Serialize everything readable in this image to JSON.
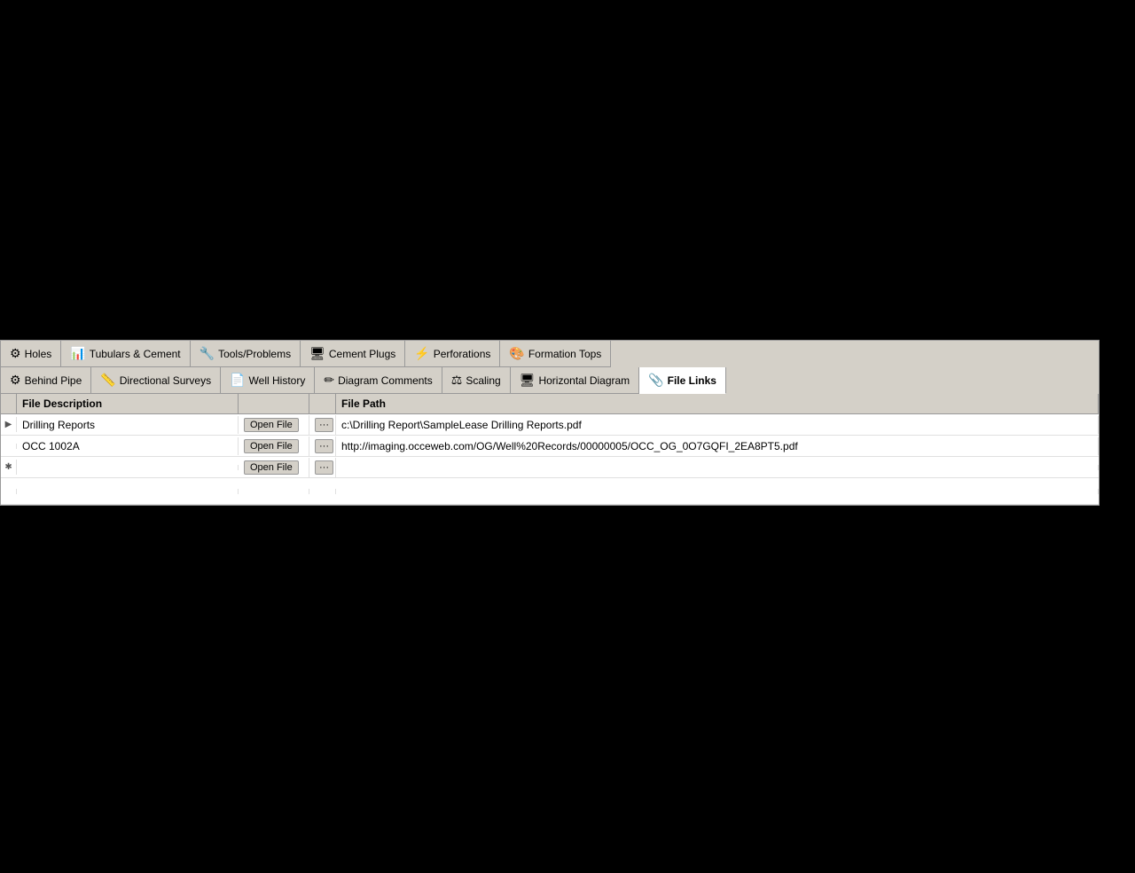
{
  "tabs_row1": [
    {
      "id": "holes",
      "label": "Holes",
      "icon": "⚙",
      "active": false
    },
    {
      "id": "tubulars-cement",
      "label": "Tubulars & Cement",
      "icon": "📊",
      "active": false
    },
    {
      "id": "tools-problems",
      "label": "Tools/Problems",
      "icon": "🔧",
      "active": false
    },
    {
      "id": "cement-plugs",
      "label": "Cement Plugs",
      "icon": "🖥",
      "active": false
    },
    {
      "id": "perforations",
      "label": "Perforations",
      "icon": "⚡",
      "active": false
    },
    {
      "id": "formation-tops",
      "label": "Formation Tops",
      "icon": "🎨",
      "active": false
    }
  ],
  "tabs_row2": [
    {
      "id": "behind-pipe",
      "label": "Behind Pipe",
      "icon": "⚙",
      "active": false
    },
    {
      "id": "directional-surveys",
      "label": "Directional Surveys",
      "icon": "📏",
      "active": false
    },
    {
      "id": "well-history",
      "label": "Well History",
      "icon": "📄",
      "active": false
    },
    {
      "id": "diagram-comments",
      "label": "Diagram Comments",
      "icon": "✏",
      "active": false
    },
    {
      "id": "scaling",
      "label": "Scaling",
      "icon": "⚖",
      "active": false
    },
    {
      "id": "horizontal-diagram",
      "label": "Horizontal Diagram",
      "icon": "🖥",
      "active": false
    },
    {
      "id": "file-links",
      "label": "File Links",
      "icon": "📎",
      "active": true
    }
  ],
  "grid": {
    "headers": {
      "indicator": "",
      "description": "File Description",
      "openfile": "",
      "ellipsis": "",
      "filepath": "File Path"
    },
    "rows": [
      {
        "indicator": "▶",
        "description": "Drilling Reports",
        "openfile": "Open File",
        "ellipsis": "···",
        "filepath": "c:\\Drilling Report\\SampleLease Drilling Reports.pdf"
      },
      {
        "indicator": "",
        "description": "OCC 1002A",
        "openfile": "Open File",
        "ellipsis": "···",
        "filepath": "http://imaging.occeweb.com/OG/Well%20Records/00000005/OCC_OG_0O7GQFI_2EA8PT5.pdf"
      },
      {
        "indicator": "✱",
        "description": "",
        "openfile": "Open File",
        "ellipsis": "···",
        "filepath": ""
      }
    ]
  }
}
